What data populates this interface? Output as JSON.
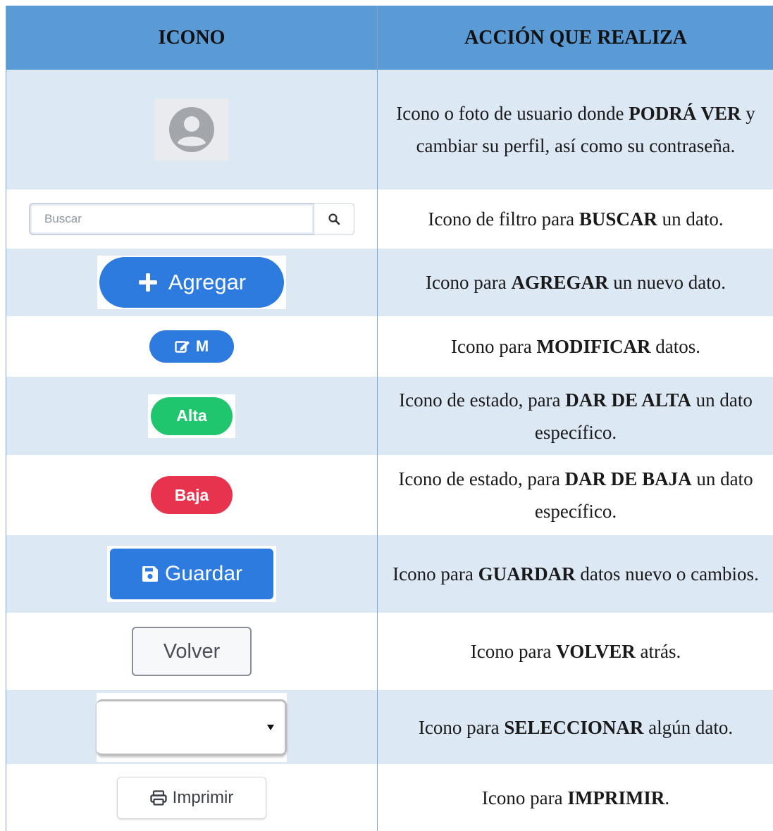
{
  "header": {
    "col_icon": "ICONO",
    "col_action": "ACCIÓN QUE REALIZA"
  },
  "rows": [
    {
      "icon": "user-avatar-icon",
      "description": [
        "Icono o foto de usuario donde ",
        "PODRÁ VER",
        " y cambiar su perfil, así como su contraseña."
      ]
    },
    {
      "icon": "search-field",
      "search_placeholder": "Buscar",
      "description": [
        "Icono de filtro para ",
        "BUSCAR",
        " un dato."
      ]
    },
    {
      "icon": "plus-icon",
      "button_label": "Agregar",
      "description": [
        "Icono para ",
        "AGREGAR",
        " un nuevo dato."
      ]
    },
    {
      "icon": "edit-icon",
      "button_label": "M",
      "description": [
        "Icono para ",
        "MODIFICAR",
        " datos."
      ]
    },
    {
      "button_label": "Alta",
      "color": "#1fc66d",
      "description": [
        "Icono de estado, para ",
        "DAR DE ALTA",
        " un dato específico."
      ]
    },
    {
      "button_label": "Baja",
      "color": "#e8334e",
      "description": [
        "Icono de estado, para ",
        "DAR DE BAJA",
        " un dato específico."
      ]
    },
    {
      "icon": "floppy-disk-icon",
      "button_label": "Guardar",
      "description": [
        "Icono para ",
        "GUARDAR",
        " datos nuevo o cambios."
      ]
    },
    {
      "button_label": "Volver",
      "description": [
        "Icono para ",
        "VOLVER",
        " atrás."
      ]
    },
    {
      "icon": "caret-down-icon",
      "description": [
        "Icono para ",
        "SELECCIONAR",
        " algún dato."
      ]
    },
    {
      "icon": "printer-icon",
      "button_label": "Imprimir",
      "description": [
        "Icono para ",
        "IMPRIMIR",
        "."
      ]
    }
  ],
  "colors": {
    "header_bg": "#5b9bd5",
    "shaded_row_bg": "#dde8f5",
    "primary_blue": "#2e7be0",
    "green": "#1fc66d",
    "red": "#e8334e"
  }
}
